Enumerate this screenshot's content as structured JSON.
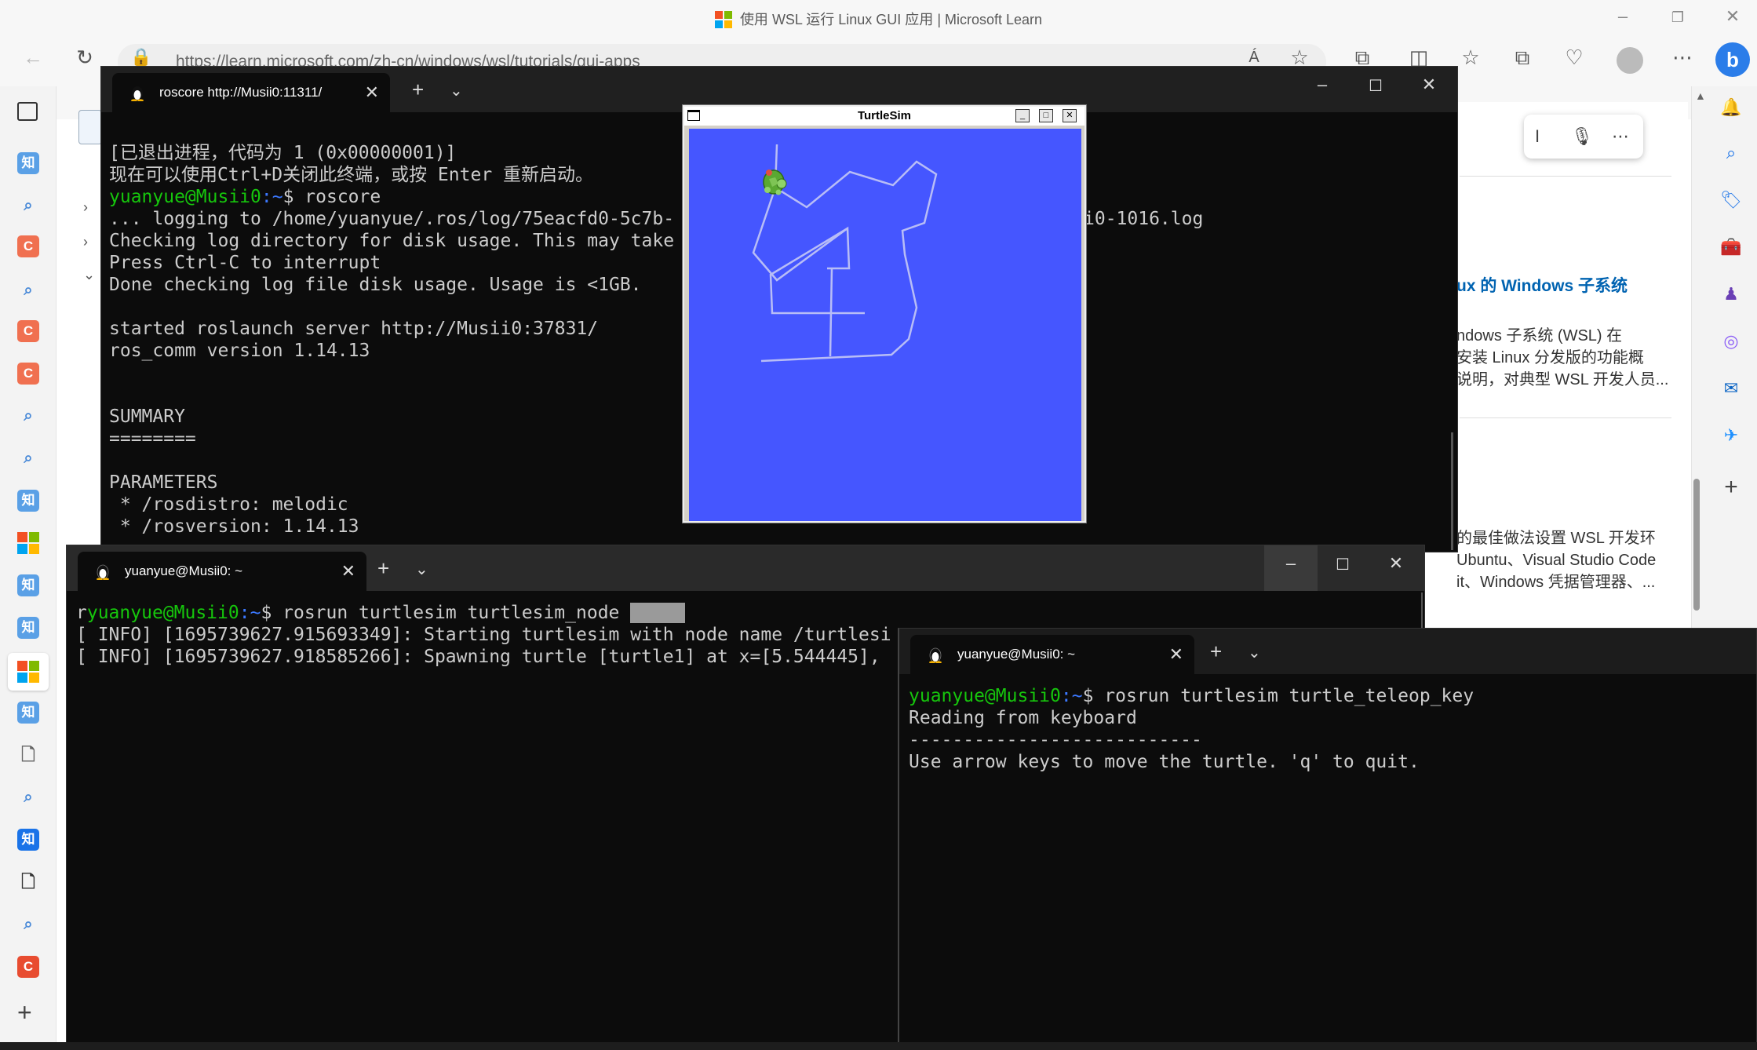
{
  "browser": {
    "title": "使用 WSL 运行 Linux GUI 应用 | Microsoft Learn",
    "url": "https://learn.microsoft.com/zh-cn/windows/wsl/tutorials/gui-apps",
    "read_aloud_label": "Á"
  },
  "left_sidebar": {
    "items": [
      {
        "icon": "tabs-icon",
        "label": ""
      },
      {
        "icon": "zhihu-icon",
        "label": "知"
      },
      {
        "icon": "search-icon",
        "label": "🔍"
      },
      {
        "icon": "csdn-icon",
        "label": "C"
      },
      {
        "icon": "search-icon",
        "label": "🔍"
      },
      {
        "icon": "csdn-icon",
        "label": "C"
      },
      {
        "icon": "csdn-icon",
        "label": "C"
      },
      {
        "icon": "search-icon",
        "label": "🔍"
      },
      {
        "icon": "search-icon",
        "label": "🔍"
      },
      {
        "icon": "zhihu-icon",
        "label": "知"
      },
      {
        "icon": "microsoft-icon",
        "label": ""
      },
      {
        "icon": "zhihu-icon",
        "label": "知"
      },
      {
        "icon": "zhihu-icon",
        "label": "知"
      },
      {
        "icon": "microsoft-icon",
        "label": ""
      },
      {
        "icon": "zhihu-icon",
        "label": "知"
      },
      {
        "icon": "document-icon",
        "label": "🗋"
      },
      {
        "icon": "search-icon",
        "label": "🔍"
      },
      {
        "icon": "zhihu-icon",
        "label": "知"
      },
      {
        "icon": "document-icon",
        "label": "🗋"
      },
      {
        "icon": "search-icon",
        "label": "🔍"
      },
      {
        "icon": "csdn-icon",
        "label": "C"
      }
    ]
  },
  "background_page": {
    "link": "ux 的 Windows 子系统",
    "para1": "ndows 子系统 (WSL) 在\n安装 Linux 分发版的功能概\n说明，对典型 WSL 开发人员...",
    "para2": "的最佳做法设置 WSL 开发环\nUbuntu、Visual Studio Code\nit、Windows 凭据管理器、..."
  },
  "terminal_roscore": {
    "tab_title": "roscore http://Musii0:11311/",
    "lines": [
      "[已退出进程，代码为 1 (0x00000001)]",
      "现在可以使用Ctrl+D关闭此终端，或按 Enter 重新启动。",
      "",
      "... logging to /home/yuanyue/.ros/log/75eacfd0-5c7b-",
      "Checking log directory for disk usage. This may take",
      "Press Ctrl-C to interrupt",
      "Done checking log file disk usage. Usage is <1GB.",
      "",
      "started roslaunch server http://Musii0:37831/",
      "ros_comm version 1.14.13",
      "",
      "",
      "SUMMARY",
      "========",
      "",
      "PARAMETERS",
      " * /rosdistro: melodic",
      " * /rosversion: 1.14.13"
    ],
    "prompt_user": "yuanyue@Musii0",
    "prompt_path": ":~",
    "prompt_cmd": "$ roscore",
    "log_tail": "i0-1016.log"
  },
  "terminal_node": {
    "tab_title": "yuanyue@Musii0: ~",
    "prompt_prefix": "r",
    "prompt_user": "yuanyue@Musii0",
    "prompt_path": ":~",
    "prompt_cmd": "$ rosrun turtlesim turtlesim_node ",
    "lines": [
      "[ INFO] [1695739627.915693349]: Starting turtlesim with node name /turtlesi",
      "[ INFO] [1695739627.918585266]: Spawning turtle [turtle1] at x=[5.544445],"
    ]
  },
  "terminal_teleop": {
    "tab_title": "yuanyue@Musii0: ~",
    "prompt_user": "yuanyue@Musii0",
    "prompt_path": ":~",
    "prompt_cmd": "$ rosrun turtlesim turtle_teleop_key",
    "lines": [
      "Reading from keyboard",
      "---------------------------",
      "Use arrow keys to move the turtle. 'q' to quit."
    ]
  },
  "turtlesim": {
    "title": "TurtleSim",
    "background_color": "#4556ff",
    "path_color": "#b3b8ff"
  },
  "colors": {
    "prompt_green": "#16c60c",
    "prompt_blue": "#3b78ff",
    "terminal_bg": "#0c0c0c"
  }
}
